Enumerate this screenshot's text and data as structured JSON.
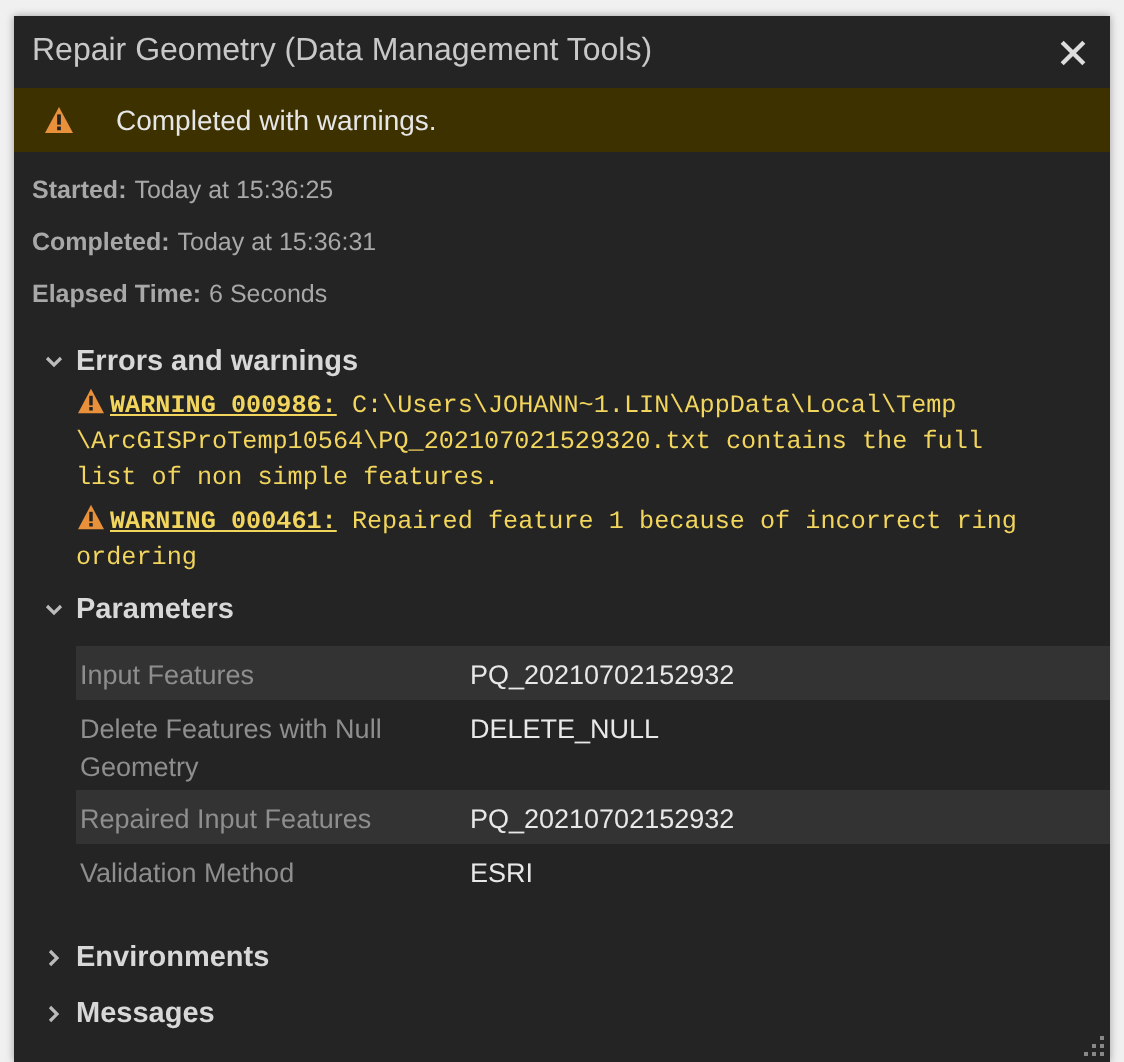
{
  "window": {
    "title": "Repair Geometry (Data Management Tools)"
  },
  "banner": {
    "message": "Completed with warnings."
  },
  "summary": [
    {
      "label": "Started:",
      "value": "Today at 15:36:25"
    },
    {
      "label": "Completed:",
      "value": "Today at 15:36:31"
    },
    {
      "label": "Elapsed Time:",
      "value": "6 Seconds"
    }
  ],
  "sections": [
    {
      "kind": "warnings",
      "title": "Errors and warnings",
      "expanded": true,
      "warnings": [
        {
          "code": "WARNING 000986:",
          "lines": [
            "C:\\Users\\JOHANN~1.LIN\\AppData\\Local\\Temp",
            "\\ArcGISProTemp10564\\PQ_202107021529320.txt contains the full",
            "list of non simple features."
          ]
        },
        {
          "code": "WARNING 000461:",
          "lines": [
            "Repaired feature 1 because of incorrect ring",
            "ordering"
          ]
        }
      ]
    },
    {
      "kind": "parameters",
      "title": "Parameters",
      "expanded": true,
      "rows": [
        {
          "name": "Input Features",
          "value": "PQ_20210702152932"
        },
        {
          "name": "Delete Features with Null Geometry",
          "value": "DELETE_NULL"
        },
        {
          "name": "Repaired Input Features",
          "value": "PQ_20210702152932"
        },
        {
          "name": "Validation Method",
          "value": "ESRI"
        }
      ]
    },
    {
      "kind": "plain",
      "title": "Environments",
      "expanded": false
    },
    {
      "kind": "plain",
      "title": "Messages",
      "expanded": false
    }
  ]
}
